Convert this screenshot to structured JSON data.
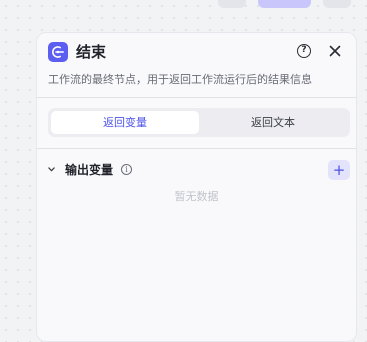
{
  "panel": {
    "title": "结束",
    "description": "工作流的最终节点，用于返回工作流运行后的结果信息",
    "icons": {
      "node": "end-node-icon",
      "help": "help-icon",
      "close": "close-icon"
    },
    "help_glyph": "?",
    "tabs": [
      {
        "label": "返回变量",
        "active": true
      },
      {
        "label": "返回文本",
        "active": false
      }
    ],
    "output": {
      "title": "输出变量",
      "info_glyph": "i",
      "add_glyph": "+",
      "empty_text": "暂无数据"
    }
  },
  "colors": {
    "accent": "#4d53e8",
    "node_icon_bg": "#5b5ef0",
    "add_button_bg": "#e3e3fb"
  }
}
